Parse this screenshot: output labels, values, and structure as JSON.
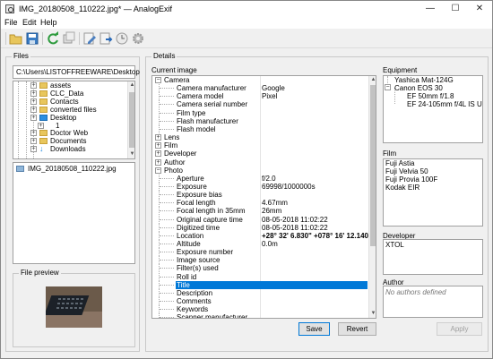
{
  "window": {
    "title": "IMG_20180508_110222.jpg* — AnalogExif"
  },
  "menubar": {
    "file": "File",
    "edit": "Edit",
    "help": "Help"
  },
  "files": {
    "group_label": "Files",
    "path": "C:\\Users\\LISTOFFREEWARE\\Desktop",
    "tree": [
      {
        "label": "assets",
        "indent": 1
      },
      {
        "label": "CLC_Data",
        "indent": 1
      },
      {
        "label": "Contacts",
        "indent": 1
      },
      {
        "label": "converted files",
        "indent": 1
      },
      {
        "label": "Desktop",
        "indent": 1
      },
      {
        "label": "1",
        "indent": 2
      },
      {
        "label": "Doctor Web",
        "indent": 1
      },
      {
        "label": "Documents",
        "indent": 1
      },
      {
        "label": "Downloads",
        "indent": 1
      }
    ],
    "file_list": [
      "IMG_20180508_110222.jpg"
    ],
    "preview_label": "File preview"
  },
  "details": {
    "group_label": "Details",
    "current_image_label": "Current image",
    "rows": [
      {
        "type": "cat",
        "label": "Camera",
        "expanded": true
      },
      {
        "type": "prop",
        "name": "Camera manufacturer",
        "value": "Google"
      },
      {
        "type": "prop",
        "name": "Camera model",
        "value": "Pixel"
      },
      {
        "type": "prop",
        "name": "Camera serial number",
        "value": ""
      },
      {
        "type": "prop",
        "name": "Film type",
        "value": ""
      },
      {
        "type": "prop",
        "name": "Flash manufacturer",
        "value": ""
      },
      {
        "type": "prop",
        "name": "Flash model",
        "value": ""
      },
      {
        "type": "cat",
        "label": "Lens",
        "expanded": false
      },
      {
        "type": "cat",
        "label": "Film",
        "expanded": false
      },
      {
        "type": "cat",
        "label": "Developer",
        "expanded": false
      },
      {
        "type": "cat",
        "label": "Author",
        "expanded": false
      },
      {
        "type": "cat",
        "label": "Photo",
        "expanded": true
      },
      {
        "type": "prop",
        "name": "Aperture",
        "value": "f/2.0"
      },
      {
        "type": "prop",
        "name": "Exposure",
        "value": "69998/1000000s"
      },
      {
        "type": "prop",
        "name": "Exposure bias",
        "value": ""
      },
      {
        "type": "prop",
        "name": "Focal length",
        "value": "4.67mm"
      },
      {
        "type": "prop",
        "name": "Focal length in 35mm",
        "value": "26mm"
      },
      {
        "type": "prop",
        "name": "Original capture time",
        "value": "08-05-2018 11:02:22"
      },
      {
        "type": "prop",
        "name": "Digitized time",
        "value": "08-05-2018 11:02:22"
      },
      {
        "type": "prop",
        "name": "Location",
        "value": "+28° 32' 6.830\" +078° 16' 12.140\"",
        "bold": true
      },
      {
        "type": "prop",
        "name": "Altitude",
        "value": "0.0m"
      },
      {
        "type": "prop",
        "name": "Exposure number",
        "value": ""
      },
      {
        "type": "prop",
        "name": "Image source",
        "value": ""
      },
      {
        "type": "prop",
        "name": "Filter(s) used",
        "value": ""
      },
      {
        "type": "prop",
        "name": "Roll id",
        "value": ""
      },
      {
        "type": "prop",
        "name": "Title",
        "value": "",
        "selected": true
      },
      {
        "type": "prop",
        "name": "Description",
        "value": ""
      },
      {
        "type": "prop",
        "name": "Comments",
        "value": ""
      },
      {
        "type": "prop",
        "name": "Keywords",
        "value": ""
      },
      {
        "type": "prop",
        "name": "Scanner manufacturer",
        "value": ""
      }
    ],
    "buttons": {
      "save": "Save",
      "revert": "Revert",
      "apply": "Apply"
    }
  },
  "equipment": {
    "label": "Equipment",
    "items": [
      {
        "label": "Yashica Mat-124G",
        "level": 0
      },
      {
        "label": "Canon EOS 30",
        "level": 0
      },
      {
        "label": "EF 50mm f/1.8",
        "level": 1
      },
      {
        "label": "EF 24-105mm f/4L IS U...",
        "level": 1
      }
    ]
  },
  "film": {
    "label": "Film",
    "items": [
      "Fuji Astia",
      "Fuji Velvia 50",
      "Fuji Provia 100F",
      "Kodak EIR"
    ]
  },
  "developer": {
    "label": "Developer",
    "items": [
      "XTOL"
    ]
  },
  "author": {
    "label": "Author",
    "placeholder": "No authors defined"
  }
}
